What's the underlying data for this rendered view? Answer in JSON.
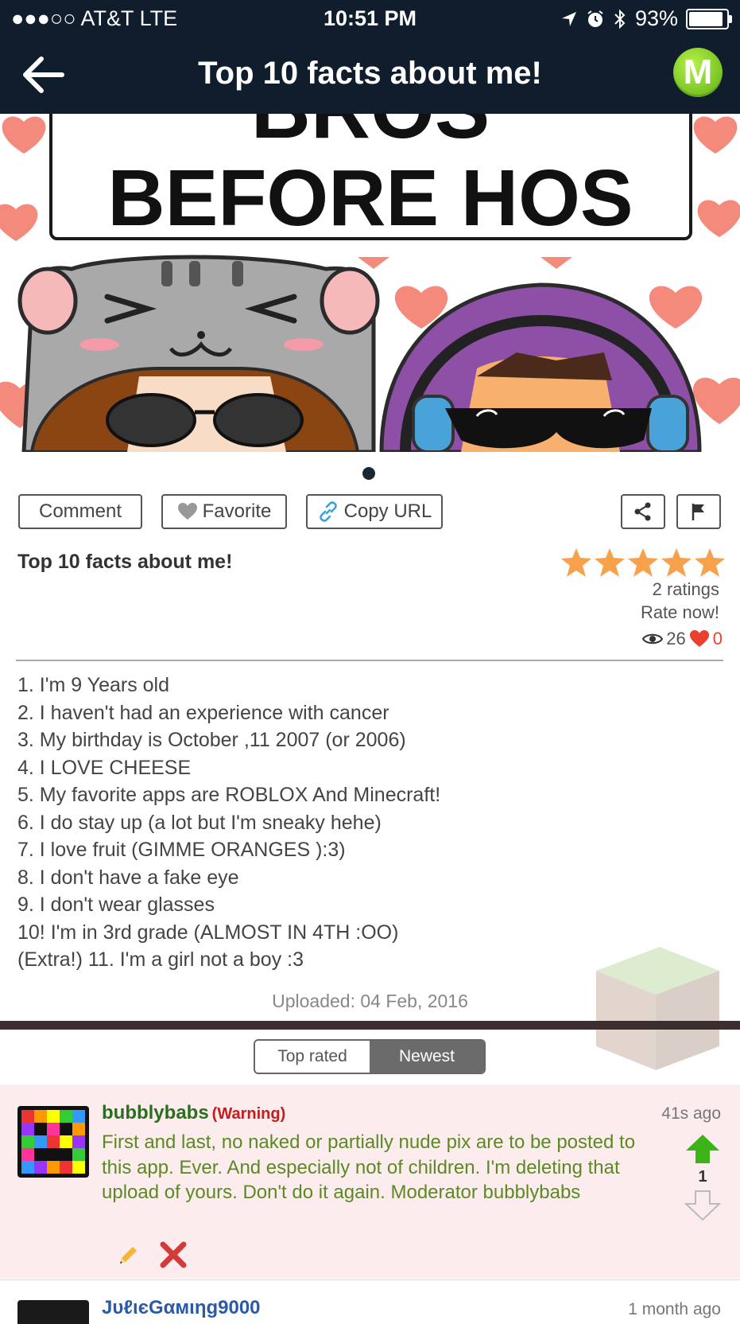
{
  "status": {
    "carrier": "●●●○○ AT&T   LTE",
    "time": "10:51 PM",
    "battery": "93%"
  },
  "nav": {
    "title": "Top 10 facts about me!",
    "logo_letter": "M"
  },
  "hero": {
    "banner_top": "BROS",
    "banner_main": "BEFORE HOS"
  },
  "actions": {
    "comment": "Comment",
    "favorite": "Favorite",
    "copy_url": "Copy URL"
  },
  "post": {
    "title": "Top 10 facts about me!",
    "rating_stars": 5,
    "ratings_count": "2 ratings",
    "rate_now": "Rate now!",
    "views": "26",
    "likes": "0",
    "lines": [
      "1. I'm 9 Years old",
      "2. I haven't had an experience with cancer",
      "3. My birthday is October ,11 2007 (or 2006)",
      "4. I LOVE CHEESE",
      "5. My favorite apps are ROBLOX And Minecraft!",
      "6. I do stay up (a lot but I'm sneaky hehe)",
      "7. I love fruit (GIMME ORANGES ):3)",
      "8. I don't have a fake eye",
      "9. I don't wear glasses",
      "10! I'm in 3rd grade (ALMOST IN 4TH :OO)",
      "(Extra!) 11. I'm a girl not a boy :3"
    ],
    "uploaded": "Uploaded: 04 Feb, 2016"
  },
  "sort": {
    "top_rated": "Top rated",
    "newest": "Newest"
  },
  "comments": [
    {
      "user": "bubblybabs",
      "tag": "(Warning)",
      "time": "41s ago",
      "text": "First and last, no naked or partially nude pix are to be posted to this app. Ever. And especially not of children. I'm deleting that upload of yours. Don't do it again. Moderator bubblybabs",
      "votes": "1"
    },
    {
      "user": "JυℓιєGαмιηg9000",
      "time": "1 month ago"
    }
  ],
  "colors": {
    "nav_bg": "#0f1d2c",
    "star": "#f7a14a",
    "comment_bg": "#fdeced",
    "username_green": "#2a6e1f",
    "warning_red": "#c41d1d"
  }
}
